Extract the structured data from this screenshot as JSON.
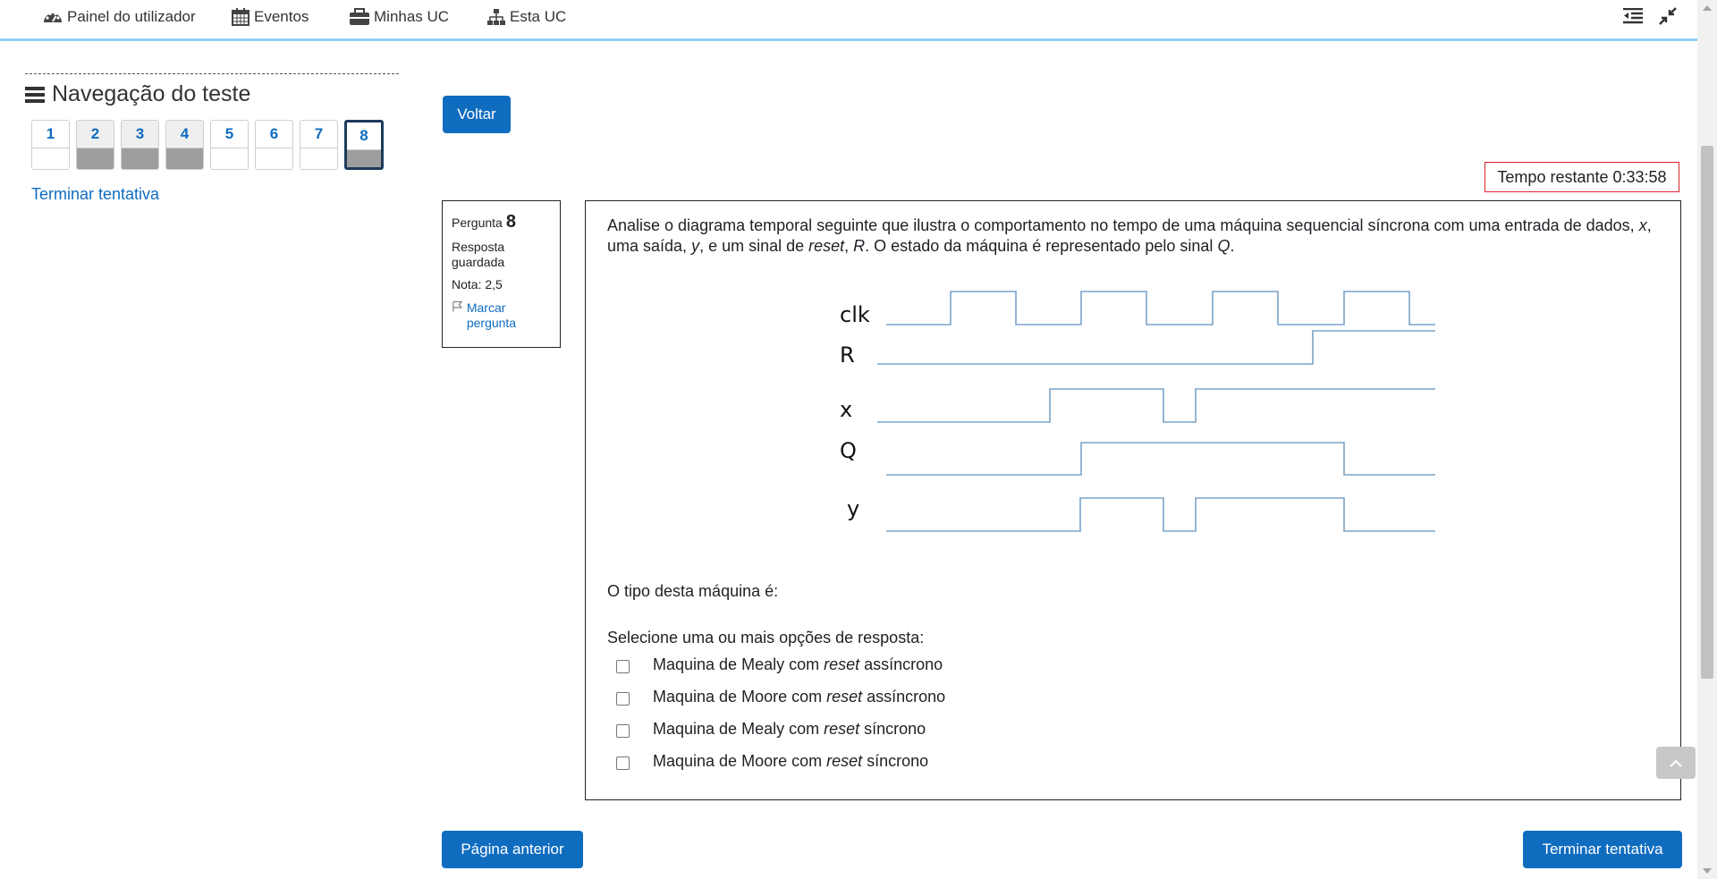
{
  "nav": {
    "dashboard": "Painel do utilizador",
    "events": "Eventos",
    "my_courses": "Minhas UC",
    "this_course": "Esta UC"
  },
  "sidebar": {
    "title": "Navegação do teste",
    "questions": [
      {
        "label": "1",
        "answered": false,
        "current": false
      },
      {
        "label": "2",
        "answered": true,
        "current": false
      },
      {
        "label": "3",
        "answered": true,
        "current": false
      },
      {
        "label": "4",
        "answered": true,
        "current": false
      },
      {
        "label": "5",
        "answered": false,
        "current": false
      },
      {
        "label": "6",
        "answered": false,
        "current": false
      },
      {
        "label": "7",
        "answered": false,
        "current": false
      },
      {
        "label": "8",
        "answered": true,
        "current": true
      }
    ],
    "finish_link": "Terminar tentativa"
  },
  "main": {
    "back_button": "Voltar",
    "timer_label": "Tempo restante",
    "timer_value": "0:33:58",
    "prev_button": "Página anterior",
    "finish_button": "Terminar tentativa"
  },
  "question": {
    "prefix": "Pergunta",
    "number": "8",
    "state": "Resposta guardada",
    "grade": "Nota: 2,5",
    "flag": "Marcar pergunta",
    "text_parts": [
      "Analise o diagrama temporal seguinte que ilustra o comportamento no tempo de uma máquina sequencial síncrona com uma entrada de dados, ",
      "x",
      ", uma saída, ",
      "y",
      ", e um sinal de ",
      "reset",
      ", ",
      "R",
      ".  O estado da máquina é representado pelo sinal ",
      "Q",
      "."
    ],
    "prompt": "O tipo desta máquina é:",
    "answer_label": "Selecione uma ou mais opções de resposta:",
    "options": [
      {
        "before": "Maquina de Mealy com ",
        "em": "reset",
        "after": " assíncrono"
      },
      {
        "before": "Maquina de Moore com ",
        "em": "reset",
        "after": " assíncrono"
      },
      {
        "before": "Maquina de Mealy com ",
        "em": "reset",
        "after": " síncrono"
      },
      {
        "before": "Maquina de Moore com ",
        "em": "reset",
        "after": " síncrono"
      }
    ]
  },
  "diagram": {
    "signals": [
      "clk",
      "R",
      "x",
      "Q",
      "y"
    ],
    "line_color": "#7aa3c8"
  }
}
